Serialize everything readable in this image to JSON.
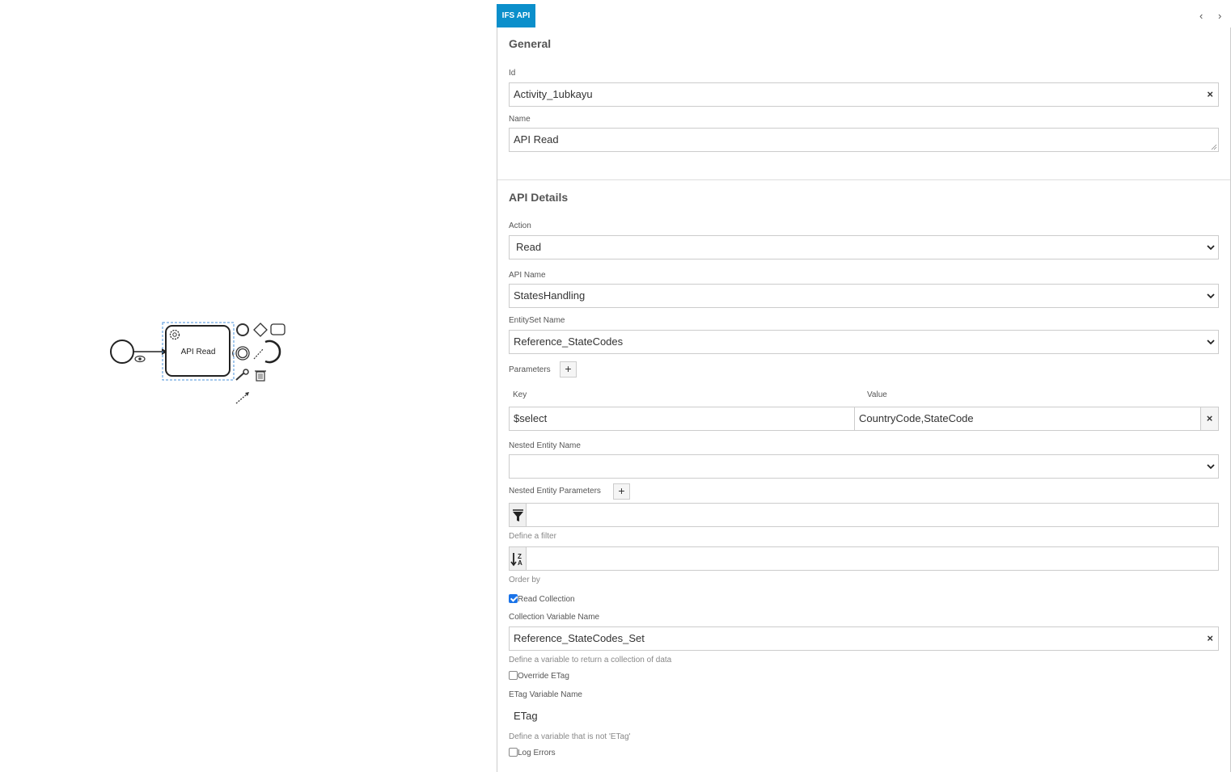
{
  "canvas": {
    "task_label": "API Read"
  },
  "panel": {
    "tab_label": "IFS API",
    "nav_prev": "‹",
    "nav_next": "›",
    "general": {
      "title": "General",
      "id_label": "Id",
      "id_value": "Activity_1ubkayu",
      "name_label": "Name",
      "name_value": "API Read"
    },
    "api": {
      "title": "API Details",
      "action_label": "Action",
      "action_value": "Read",
      "api_name_label": "API Name",
      "api_name_value": "StatesHandling",
      "entityset_label": "EntitySet Name",
      "entityset_value": "Reference_StateCodes",
      "parameters_label": "Parameters",
      "key_header": "Key",
      "value_header": "Value",
      "param_key": "$select",
      "param_value": "CountryCode,StateCode",
      "nested_entity_label": "Nested Entity Name",
      "nested_entity_value": "",
      "nested_params_label": "Nested Entity Parameters",
      "filter_hint": "Define a filter",
      "order_hint": "Order by",
      "read_collection_label": "Read Collection",
      "read_collection_checked": true,
      "collection_var_label": "Collection Variable Name",
      "collection_var_value": "Reference_StateCodes_Set",
      "collection_var_hint": "Define a variable to return a collection of data",
      "override_etag_label": "Override ETag",
      "override_etag_checked": false,
      "etag_var_label": "ETag Variable Name",
      "etag_var_value": "ETag",
      "etag_var_hint": "Define a variable that is not 'ETag'",
      "log_errors_label": "Log Errors",
      "log_errors_checked": false,
      "clear_symbol": "×",
      "plus_symbol": "+"
    }
  }
}
